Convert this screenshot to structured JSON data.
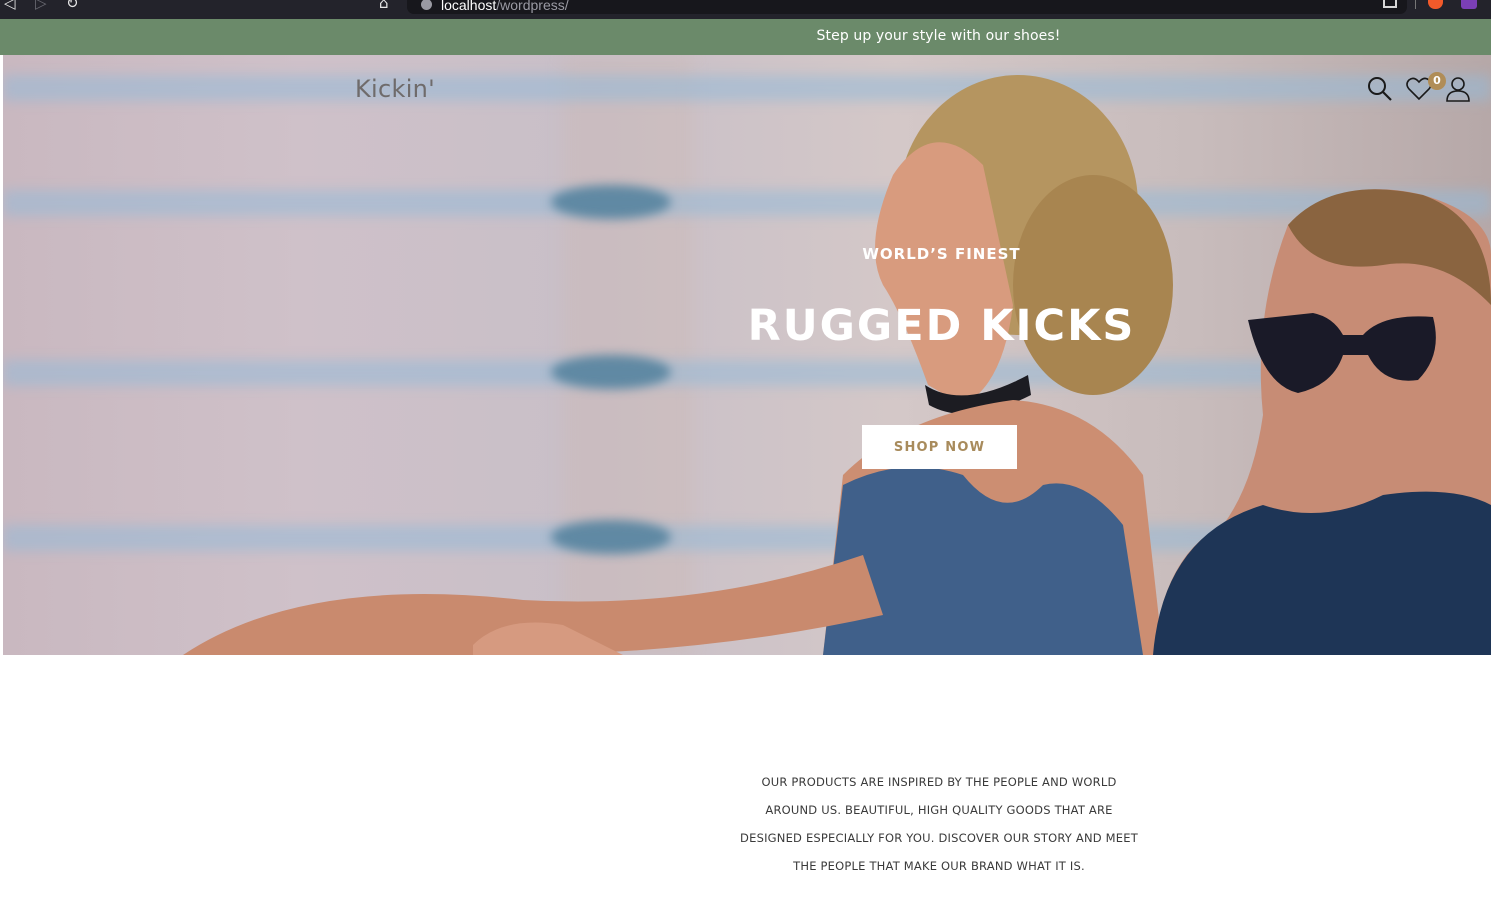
{
  "browser": {
    "url_host": "localhost",
    "url_path": "/wordpress/"
  },
  "announcement": {
    "text": "Step up your style with our shoes!"
  },
  "header": {
    "logo": "Kickin'",
    "wishlist_count": "0"
  },
  "hero": {
    "subtitle": "WORLD’S FINEST",
    "title": "RUGGED KICKS",
    "button_label": "SHOP NOW"
  },
  "about": {
    "text": "OUR PRODUCTS ARE INSPIRED BY THE PEOPLE AND WORLD AROUND US. BEAUTIFUL, HIGH QUALITY GOODS THAT ARE DESIGNED ESPECIALLY FOR YOU. DISCOVER OUR STORY AND MEET THE PEOPLE THAT MAKE OUR BRAND WHAT IT IS."
  },
  "colors": {
    "announcement_bg": "#6b8a6a",
    "accent": "#b08d57",
    "button_text": "#a88b5c"
  },
  "icons": [
    "back-icon",
    "forward-icon",
    "reload-icon",
    "bookmark-icon",
    "site-info-icon",
    "share-icon",
    "brave-shield-icon",
    "extension-icon",
    "search-icon",
    "heart-icon",
    "user-icon"
  ]
}
